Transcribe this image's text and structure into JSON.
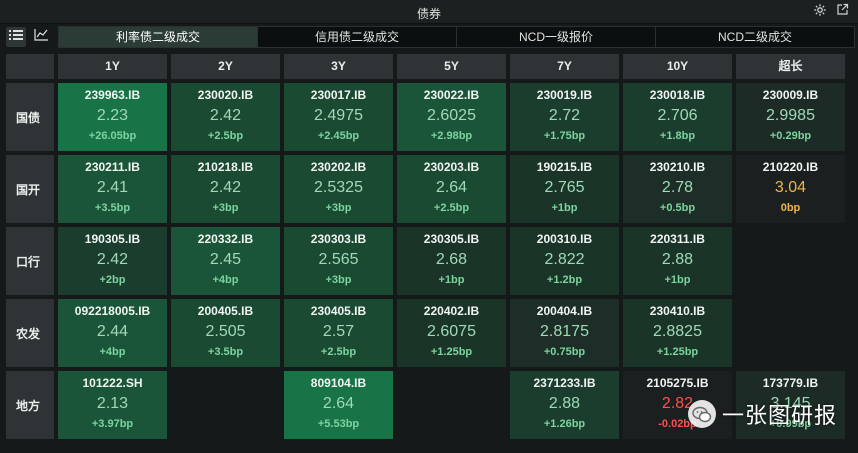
{
  "window": {
    "title": "债券"
  },
  "toolbar": {
    "tabs": [
      {
        "label": "利率债二级成交",
        "active": true
      },
      {
        "label": "信用债二级成交",
        "active": false
      },
      {
        "label": "NCD一级报价",
        "active": false
      },
      {
        "label": "NCD二级成交",
        "active": false
      }
    ]
  },
  "grid": {
    "columns": [
      "1Y",
      "2Y",
      "3Y",
      "5Y",
      "7Y",
      "10Y",
      "超长"
    ],
    "rows": [
      {
        "label": "国债",
        "cells": [
          {
            "code": "239963.IB",
            "yield": "2.23",
            "change": "+26.05bp",
            "bg": "#187346",
            "tone": "up"
          },
          {
            "code": "230020.IB",
            "yield": "2.42",
            "change": "+2.5bp",
            "bg": "#1b4a33",
            "tone": "up"
          },
          {
            "code": "230017.IB",
            "yield": "2.4975",
            "change": "+2.45bp",
            "bg": "#1b4a33",
            "tone": "up"
          },
          {
            "code": "230022.IB",
            "yield": "2.6025",
            "change": "+2.98bp",
            "bg": "#1b5539",
            "tone": "up"
          },
          {
            "code": "230019.IB",
            "yield": "2.72",
            "change": "+1.75bp",
            "bg": "#1a3d2d",
            "tone": "up"
          },
          {
            "code": "230018.IB",
            "yield": "2.706",
            "change": "+1.8bp",
            "bg": "#1a3d2d",
            "tone": "up"
          },
          {
            "code": "230009.IB",
            "yield": "2.9985",
            "change": "+0.29bp",
            "bg": "#1d2b26",
            "tone": "up"
          }
        ]
      },
      {
        "label": "国开",
        "cells": [
          {
            "code": "230211.IB",
            "yield": "2.41",
            "change": "+3.5bp",
            "bg": "#1b5539",
            "tone": "up"
          },
          {
            "code": "210218.IB",
            "yield": "2.42",
            "change": "+3bp",
            "bg": "#1b4a33",
            "tone": "up"
          },
          {
            "code": "230202.IB",
            "yield": "2.5325",
            "change": "+3bp",
            "bg": "#1b4a33",
            "tone": "up"
          },
          {
            "code": "230203.IB",
            "yield": "2.64",
            "change": "+2.5bp",
            "bg": "#1b4a33",
            "tone": "up"
          },
          {
            "code": "190215.IB",
            "yield": "2.765",
            "change": "+1bp",
            "bg": "#1a3528",
            "tone": "up"
          },
          {
            "code": "230210.IB",
            "yield": "2.78",
            "change": "+0.5bp",
            "bg": "#1c2e27",
            "tone": "up"
          },
          {
            "code": "210220.IB",
            "yield": "3.04",
            "change": "0bp",
            "bg": "#1b1f1f",
            "tone": "flat"
          }
        ]
      },
      {
        "label": "口行",
        "cells": [
          {
            "code": "190305.IB",
            "yield": "2.42",
            "change": "+2bp",
            "bg": "#1a3d2d",
            "tone": "up"
          },
          {
            "code": "220332.IB",
            "yield": "2.45",
            "change": "+4bp",
            "bg": "#1b5539",
            "tone": "up"
          },
          {
            "code": "230303.IB",
            "yield": "2.565",
            "change": "+3bp",
            "bg": "#1b4a33",
            "tone": "up"
          },
          {
            "code": "230305.IB",
            "yield": "2.68",
            "change": "+1bp",
            "bg": "#1a3528",
            "tone": "up"
          },
          {
            "code": "200310.IB",
            "yield": "2.822",
            "change": "+1.2bp",
            "bg": "#1a3528",
            "tone": "up"
          },
          {
            "code": "220311.IB",
            "yield": "2.88",
            "change": "+1bp",
            "bg": "#1a3528",
            "tone": "up"
          },
          null
        ]
      },
      {
        "label": "农发",
        "cells": [
          {
            "code": "092218005.IB",
            "yield": "2.44",
            "change": "+4bp",
            "bg": "#1b5539",
            "tone": "up"
          },
          {
            "code": "200405.IB",
            "yield": "2.505",
            "change": "+3.5bp",
            "bg": "#1b4a33",
            "tone": "up"
          },
          {
            "code": "230405.IB",
            "yield": "2.57",
            "change": "+2.5bp",
            "bg": "#1b4a33",
            "tone": "up"
          },
          {
            "code": "220402.IB",
            "yield": "2.6075",
            "change": "+1.25bp",
            "bg": "#1a3528",
            "tone": "up"
          },
          {
            "code": "200404.IB",
            "yield": "2.8175",
            "change": "+0.75bp",
            "bg": "#1c2e27",
            "tone": "up"
          },
          {
            "code": "230410.IB",
            "yield": "2.8825",
            "change": "+1.25bp",
            "bg": "#1a3528",
            "tone": "up"
          },
          null
        ]
      },
      {
        "label": "地方",
        "cells": [
          {
            "code": "101222.SH",
            "yield": "2.13",
            "change": "+3.97bp",
            "bg": "#1b5539",
            "tone": "up"
          },
          null,
          {
            "code": "809104.IB",
            "yield": "2.64",
            "change": "+5.53bp",
            "bg": "#187346",
            "tone": "up"
          },
          null,
          {
            "code": "2371233.IB",
            "yield": "2.88",
            "change": "+1.26bp",
            "bg": "#1a3d2d",
            "tone": "up"
          },
          {
            "code": "2105275.IB",
            "yield": "2.82",
            "change": "-0.02bp",
            "bg": "#1b1f1f",
            "tone": "neg"
          },
          {
            "code": "173779.IB",
            "yield": "3.145",
            "change": "+0.99bp",
            "bg": "#1d2b26",
            "tone": "up"
          }
        ]
      }
    ]
  },
  "watermark": {
    "text": "一张图研报"
  },
  "icons": {
    "settings": "gear-icon",
    "popout": "external-link-icon",
    "list_view": "list-icon",
    "chart_view": "line-chart-icon"
  }
}
